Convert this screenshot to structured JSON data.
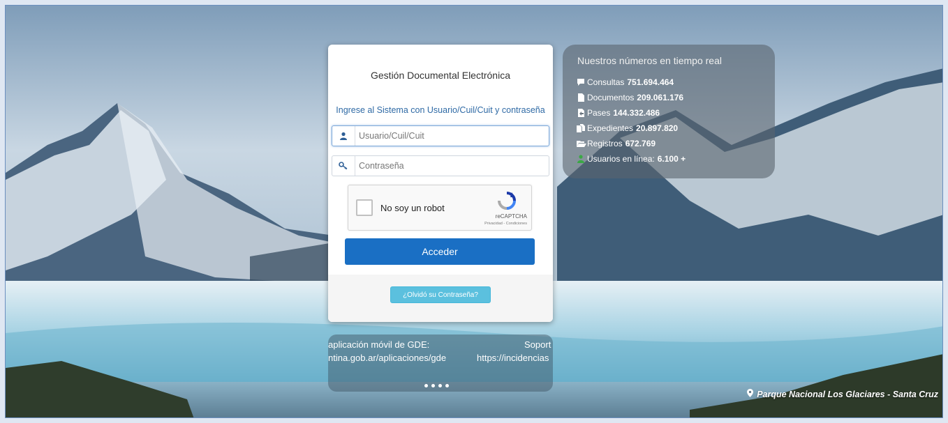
{
  "login": {
    "title": "Gestión Documental Electrónica",
    "subtitle": "Ingrese al Sistema con Usuario/Cuil/Cuit y contraseña",
    "username_placeholder": "Usuario/Cuil/Cuit",
    "password_placeholder": "Contraseña",
    "captcha_label": "No soy un robot",
    "captcha_brand": "reCAPTCHA",
    "captcha_links": "Privacidad - Condiciones",
    "submit_label": "Acceder",
    "forgot_label": "¿Olvidó su Contraseña?"
  },
  "stats": {
    "title": "Nuestros números en tiempo real",
    "items": [
      {
        "label": "Consultas",
        "value": "751.694.464",
        "icon": "comment-icon"
      },
      {
        "label": "Documentos",
        "value": "209.061.176",
        "icon": "document-icon"
      },
      {
        "label": "Pases",
        "value": "144.332.486",
        "icon": "pass-icon"
      },
      {
        "label": "Expedientes",
        "value": "20.897.820",
        "icon": "files-icon"
      },
      {
        "label": "Registros",
        "value": "672.769",
        "icon": "folder-open-icon"
      },
      {
        "label": "Usuarios en línea:",
        "value": "6.100 +",
        "icon": "user-green-icon"
      }
    ]
  },
  "carousel": {
    "line1_left": "aplicación móvil de GDE:",
    "line1_right": "Soport",
    "line2_left": "ntina.gob.ar/aplicaciones/gde",
    "line2_right": "https://incidencias"
  },
  "location": "Parque Nacional Los Glaciares - Santa Cruz",
  "colors": {
    "accent": "#1a6fc4",
    "link": "#2f6aa5",
    "info_button": "#5bc0de",
    "online_green": "#3aa845"
  }
}
